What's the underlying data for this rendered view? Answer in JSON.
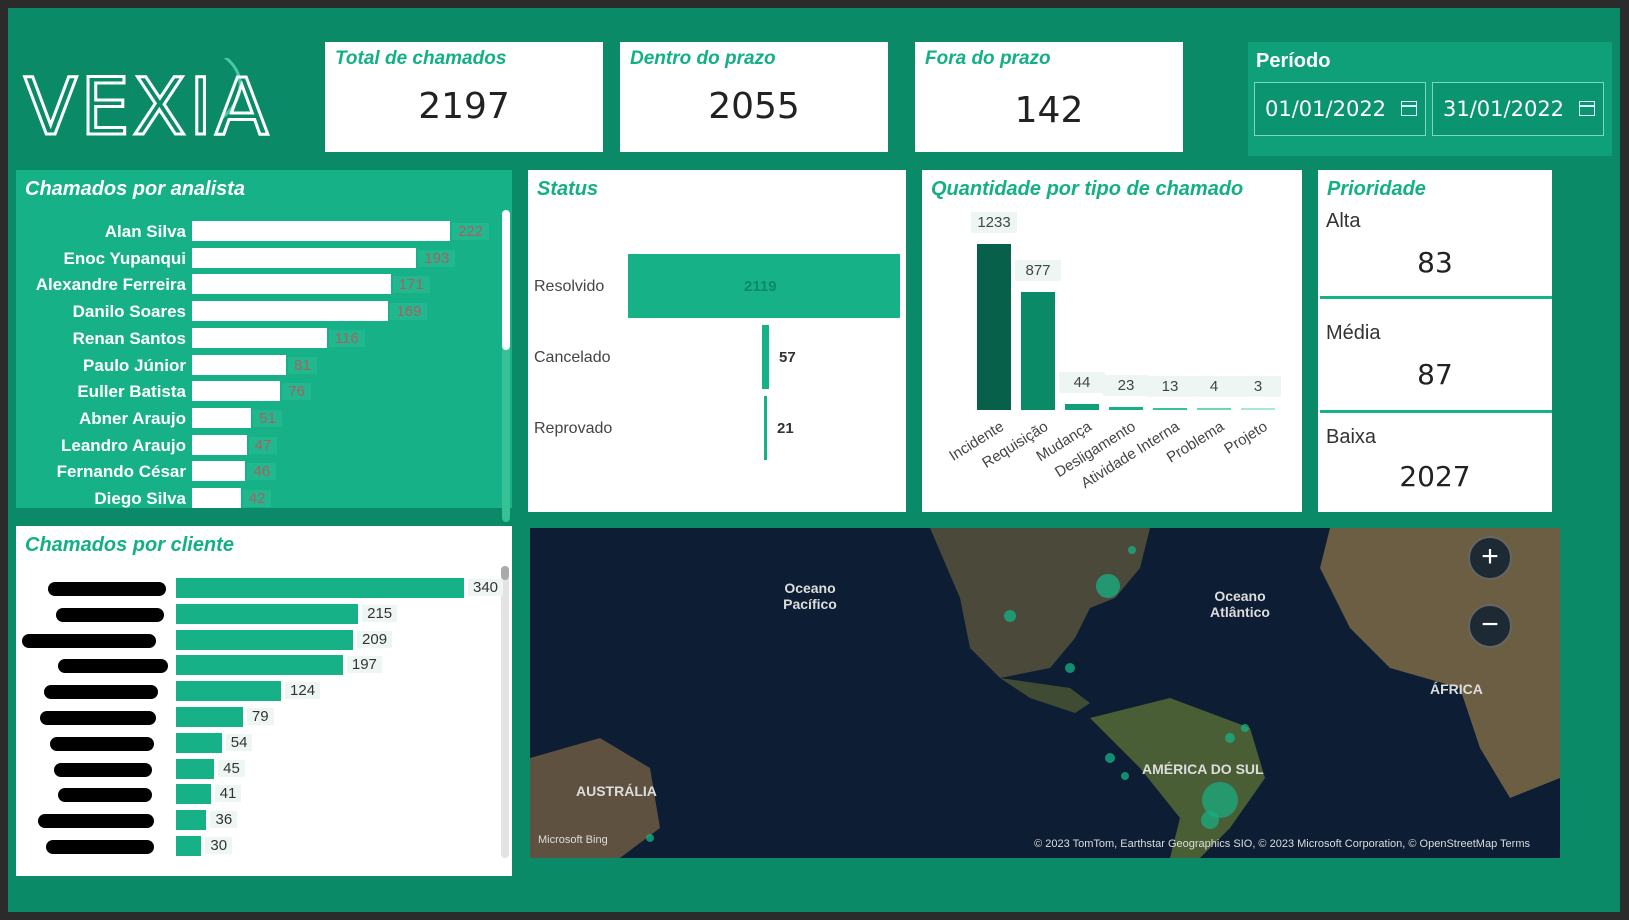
{
  "logo": {
    "text": "VEXIA"
  },
  "kpis": [
    {
      "title": "Total de chamados",
      "value": "2197"
    },
    {
      "title": "Dentro do prazo",
      "value": "2055"
    },
    {
      "title": "Fora do prazo",
      "value": "142"
    }
  ],
  "period": {
    "title": "Período",
    "start": "01/01/2022",
    "end": "31/01/2022"
  },
  "analysts": {
    "title": "Chamados por analista",
    "rows": [
      {
        "name": "Alan Silva",
        "value": 222
      },
      {
        "name": "Enoc Yupanqui",
        "value": 193
      },
      {
        "name": "Alexandre Ferreira",
        "value": 171
      },
      {
        "name": "Danilo Soares",
        "value": 169
      },
      {
        "name": "Renan Santos",
        "value": 116
      },
      {
        "name": "Paulo Júnior",
        "value": 81
      },
      {
        "name": "Euller Batista",
        "value": 76
      },
      {
        "name": "Abner Araujo",
        "value": 51
      },
      {
        "name": "Leandro Araujo",
        "value": 47
      },
      {
        "name": "Fernando César",
        "value": 46
      },
      {
        "name": "Diego Silva",
        "value": 42
      }
    ]
  },
  "clients": {
    "title": "Chamados por cliente",
    "rows": [
      {
        "value": 340
      },
      {
        "value": 215
      },
      {
        "value": 209
      },
      {
        "value": 197
      },
      {
        "value": 124
      },
      {
        "value": 79
      },
      {
        "value": 54
      },
      {
        "value": 45
      },
      {
        "value": 41
      },
      {
        "value": 36
      },
      {
        "value": 30
      }
    ]
  },
  "status": {
    "title": "Status",
    "rows": [
      {
        "label": "Resolvido",
        "value": 2119
      },
      {
        "label": "Cancelado",
        "value": 57
      },
      {
        "label": "Reprovado",
        "value": 21
      }
    ]
  },
  "chart_data": {
    "type": "bar",
    "title": "Quantidade por tipo de chamado",
    "categories": [
      "Incidente",
      "Requisição",
      "Mudança",
      "Desligamento",
      "Atividade Interna",
      "Problema",
      "Projeto"
    ],
    "values": [
      1233,
      877,
      44,
      23,
      13,
      4,
      3
    ],
    "colors": [
      "#06604a",
      "#0b8a68",
      "#0fa07a",
      "#16b186",
      "#35c29a",
      "#6fd5b6",
      "#a7e8d4"
    ]
  },
  "priority": {
    "title": "Prioridade",
    "items": [
      {
        "name": "Alta",
        "value": "83"
      },
      {
        "name": "Média",
        "value": "87"
      },
      {
        "name": "Baixa",
        "value": "2027"
      }
    ]
  },
  "map": {
    "labels": [
      "Oceano Pacífico",
      "Oceano Atlântico",
      "ÁFRICA",
      "AMÉRICA DO SUL",
      "AUSTRÁLIA"
    ],
    "credit": "© 2023 TomTom, Earthstar Geographics SIO, © 2023 Microsoft Corporation, © OpenStreetMap  Terms",
    "bing": "Microsoft Bing",
    "zoom_in": "+",
    "zoom_out": "−"
  },
  "colors": {
    "background": "#0b8a68",
    "accent": "#16b186",
    "panel": "#ffffff"
  }
}
